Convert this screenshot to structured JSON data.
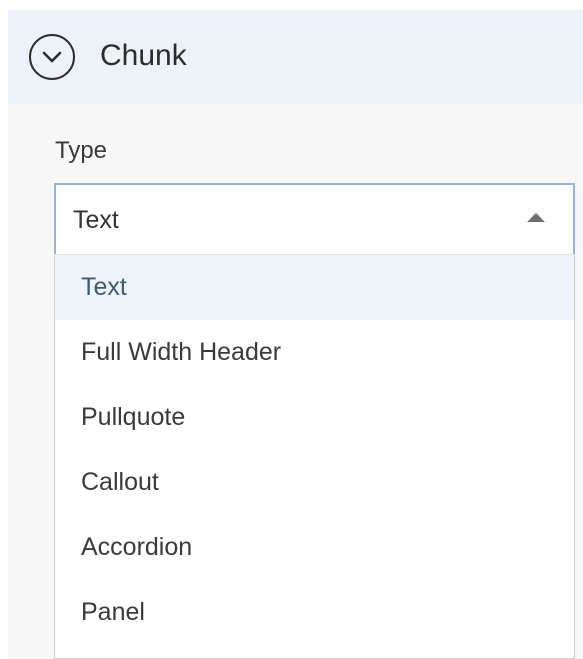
{
  "section": {
    "title": "Chunk",
    "toggle_icon": "chevron-down-circle-icon"
  },
  "type_field": {
    "label": "Type",
    "selected_value": "Text",
    "caret_icon": "caret-up-icon",
    "options": [
      {
        "label": "Text",
        "selected": true
      },
      {
        "label": "Full Width Header",
        "selected": false
      },
      {
        "label": "Pullquote",
        "selected": false
      },
      {
        "label": "Callout",
        "selected": false
      },
      {
        "label": "Accordion",
        "selected": false
      },
      {
        "label": "Panel",
        "selected": false
      }
    ]
  },
  "colors": {
    "header_background": "#edf2f8",
    "panel_background": "#f7f7f7",
    "select_border_focus": "#93b6d6",
    "option_highlight": "#eef4fa",
    "option_highlight_text": "#3d5a76"
  }
}
